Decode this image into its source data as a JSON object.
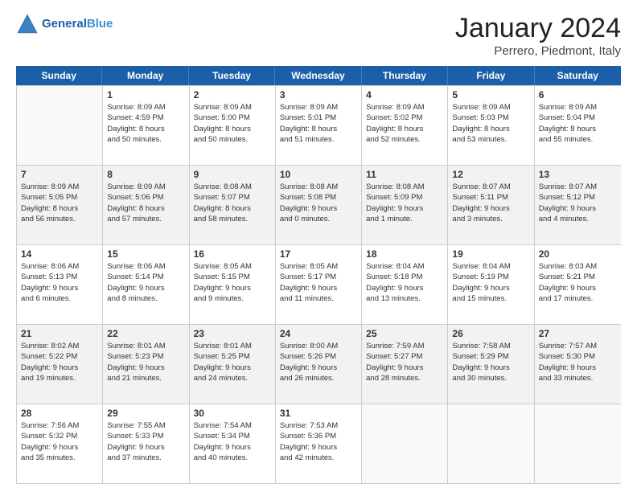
{
  "header": {
    "logo_general": "General",
    "logo_blue": "Blue",
    "month": "January 2024",
    "location": "Perrero, Piedmont, Italy"
  },
  "days_of_week": [
    "Sunday",
    "Monday",
    "Tuesday",
    "Wednesday",
    "Thursday",
    "Friday",
    "Saturday"
  ],
  "weeks": [
    [
      {
        "day": "",
        "info": ""
      },
      {
        "day": "1",
        "info": "Sunrise: 8:09 AM\nSunset: 4:59 PM\nDaylight: 8 hours\nand 50 minutes."
      },
      {
        "day": "2",
        "info": "Sunrise: 8:09 AM\nSunset: 5:00 PM\nDaylight: 8 hours\nand 50 minutes."
      },
      {
        "day": "3",
        "info": "Sunrise: 8:09 AM\nSunset: 5:01 PM\nDaylight: 8 hours\nand 51 minutes."
      },
      {
        "day": "4",
        "info": "Sunrise: 8:09 AM\nSunset: 5:02 PM\nDaylight: 8 hours\nand 52 minutes."
      },
      {
        "day": "5",
        "info": "Sunrise: 8:09 AM\nSunset: 5:03 PM\nDaylight: 8 hours\nand 53 minutes."
      },
      {
        "day": "6",
        "info": "Sunrise: 8:09 AM\nSunset: 5:04 PM\nDaylight: 8 hours\nand 55 minutes."
      }
    ],
    [
      {
        "day": "7",
        "info": "Sunrise: 8:09 AM\nSunset: 5:05 PM\nDaylight: 8 hours\nand 56 minutes."
      },
      {
        "day": "8",
        "info": "Sunrise: 8:09 AM\nSunset: 5:06 PM\nDaylight: 8 hours\nand 57 minutes."
      },
      {
        "day": "9",
        "info": "Sunrise: 8:08 AM\nSunset: 5:07 PM\nDaylight: 8 hours\nand 58 minutes."
      },
      {
        "day": "10",
        "info": "Sunrise: 8:08 AM\nSunset: 5:08 PM\nDaylight: 9 hours\nand 0 minutes."
      },
      {
        "day": "11",
        "info": "Sunrise: 8:08 AM\nSunset: 5:09 PM\nDaylight: 9 hours\nand 1 minute."
      },
      {
        "day": "12",
        "info": "Sunrise: 8:07 AM\nSunset: 5:11 PM\nDaylight: 9 hours\nand 3 minutes."
      },
      {
        "day": "13",
        "info": "Sunrise: 8:07 AM\nSunset: 5:12 PM\nDaylight: 9 hours\nand 4 minutes."
      }
    ],
    [
      {
        "day": "14",
        "info": "Sunrise: 8:06 AM\nSunset: 5:13 PM\nDaylight: 9 hours\nand 6 minutes."
      },
      {
        "day": "15",
        "info": "Sunrise: 8:06 AM\nSunset: 5:14 PM\nDaylight: 9 hours\nand 8 minutes."
      },
      {
        "day": "16",
        "info": "Sunrise: 8:05 AM\nSunset: 5:15 PM\nDaylight: 9 hours\nand 9 minutes."
      },
      {
        "day": "17",
        "info": "Sunrise: 8:05 AM\nSunset: 5:17 PM\nDaylight: 9 hours\nand 11 minutes."
      },
      {
        "day": "18",
        "info": "Sunrise: 8:04 AM\nSunset: 5:18 PM\nDaylight: 9 hours\nand 13 minutes."
      },
      {
        "day": "19",
        "info": "Sunrise: 8:04 AM\nSunset: 5:19 PM\nDaylight: 9 hours\nand 15 minutes."
      },
      {
        "day": "20",
        "info": "Sunrise: 8:03 AM\nSunset: 5:21 PM\nDaylight: 9 hours\nand 17 minutes."
      }
    ],
    [
      {
        "day": "21",
        "info": "Sunrise: 8:02 AM\nSunset: 5:22 PM\nDaylight: 9 hours\nand 19 minutes."
      },
      {
        "day": "22",
        "info": "Sunrise: 8:01 AM\nSunset: 5:23 PM\nDaylight: 9 hours\nand 21 minutes."
      },
      {
        "day": "23",
        "info": "Sunrise: 8:01 AM\nSunset: 5:25 PM\nDaylight: 9 hours\nand 24 minutes."
      },
      {
        "day": "24",
        "info": "Sunrise: 8:00 AM\nSunset: 5:26 PM\nDaylight: 9 hours\nand 26 minutes."
      },
      {
        "day": "25",
        "info": "Sunrise: 7:59 AM\nSunset: 5:27 PM\nDaylight: 9 hours\nand 28 minutes."
      },
      {
        "day": "26",
        "info": "Sunrise: 7:58 AM\nSunset: 5:29 PM\nDaylight: 9 hours\nand 30 minutes."
      },
      {
        "day": "27",
        "info": "Sunrise: 7:57 AM\nSunset: 5:30 PM\nDaylight: 9 hours\nand 33 minutes."
      }
    ],
    [
      {
        "day": "28",
        "info": "Sunrise: 7:56 AM\nSunset: 5:32 PM\nDaylight: 9 hours\nand 35 minutes."
      },
      {
        "day": "29",
        "info": "Sunrise: 7:55 AM\nSunset: 5:33 PM\nDaylight: 9 hours\nand 37 minutes."
      },
      {
        "day": "30",
        "info": "Sunrise: 7:54 AM\nSunset: 5:34 PM\nDaylight: 9 hours\nand 40 minutes."
      },
      {
        "day": "31",
        "info": "Sunrise: 7:53 AM\nSunset: 5:36 PM\nDaylight: 9 hours\nand 42 minutes."
      },
      {
        "day": "",
        "info": ""
      },
      {
        "day": "",
        "info": ""
      },
      {
        "day": "",
        "info": ""
      }
    ]
  ]
}
